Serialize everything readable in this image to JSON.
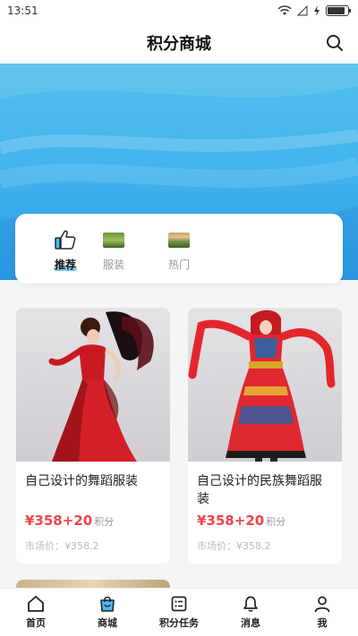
{
  "status": {
    "time": "13:51",
    "battery_level": 0.85
  },
  "header": {
    "title": "积分商城",
    "search_icon": "search-icon"
  },
  "categories": [
    {
      "label": "推荐",
      "icon": "thumbs-up-icon",
      "active": true
    },
    {
      "label": "服装",
      "icon": "clothing-thumbnail",
      "active": false
    },
    {
      "label": "热门",
      "icon": "hot-thumbnail",
      "active": false
    }
  ],
  "products": [
    {
      "title": "自己设计的舞蹈服装",
      "price": "¥358+20",
      "price_unit": "积分",
      "market_price": "市场价：¥358.2"
    },
    {
      "title": "自己设计的民族舞蹈服装",
      "price": "¥358+20",
      "price_unit": "积分",
      "market_price": "市场价：¥358.2"
    }
  ],
  "tabbar": [
    {
      "label": "首页",
      "icon": "home-icon"
    },
    {
      "label": "商城",
      "icon": "shopping-bag-icon"
    },
    {
      "label": "积分任务",
      "icon": "task-list-icon"
    },
    {
      "label": "消息",
      "icon": "bell-icon"
    },
    {
      "label": "我",
      "icon": "user-icon"
    }
  ],
  "colors": {
    "accent": "#4cb8ee",
    "price": "#f0434d",
    "tab_active": "#4cb8ee"
  }
}
